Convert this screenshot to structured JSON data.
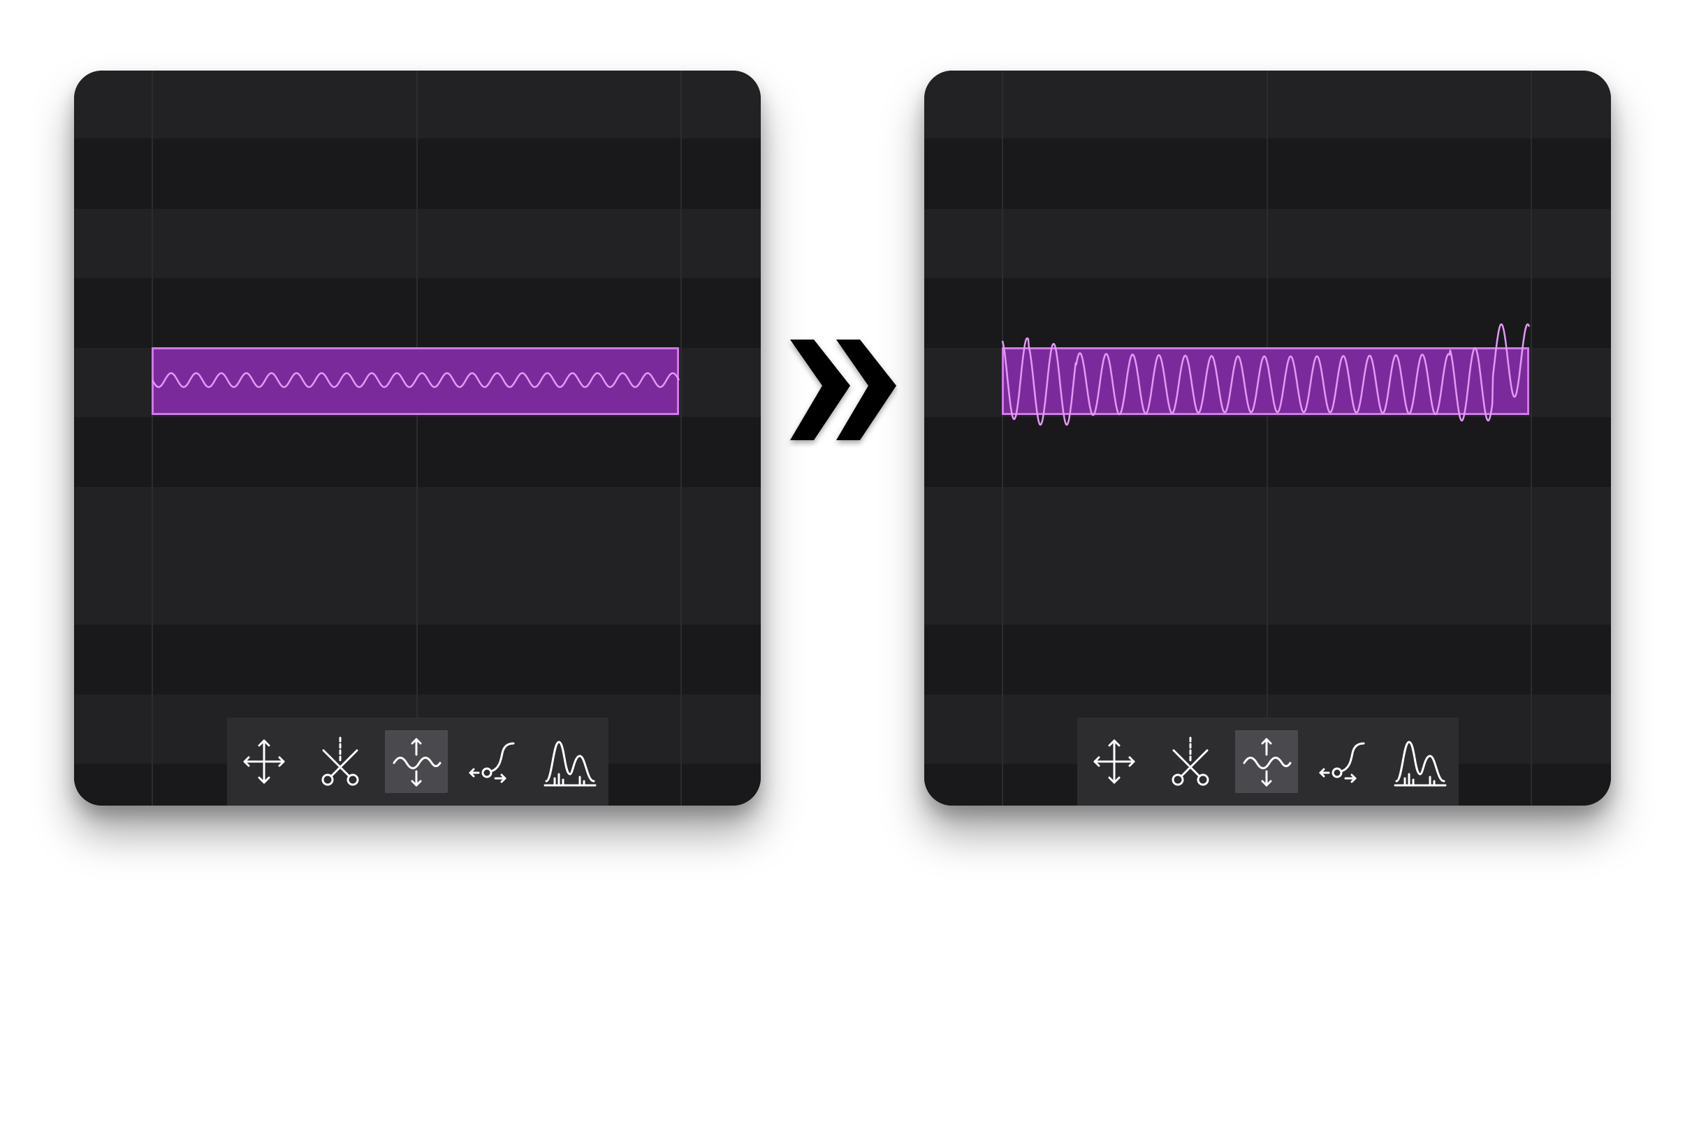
{
  "scene": "before-after-comparison",
  "colors": {
    "page_background": "#ffffff",
    "panel_stripe_light": "#222224",
    "panel_stripe_dark": "#19191b",
    "grid_line": "#2c2c2f",
    "note_fill": "#7b2a9c",
    "note_border": "#d07ae6",
    "waveform": "#e39af5",
    "toolbar_background": "#2d2d30",
    "toolbar_active": "#4a4a4e",
    "icon_color": "#ffffff",
    "arrow_color": "#000000"
  },
  "transition_icon": "double-chevron-right-icon",
  "panels": [
    {
      "id": "before",
      "waveform_style": "low-amplitude vibrato",
      "toolbar": {
        "active_tool": "pitch-modulation-tool",
        "tools": [
          {
            "id": "move-tool",
            "icon": "move-arrows-icon"
          },
          {
            "id": "split-tool",
            "icon": "scissors-icon"
          },
          {
            "id": "pitch-modulation-tool",
            "icon": "wave-updown-icon"
          },
          {
            "id": "pitch-drift-tool",
            "icon": "curve-handle-icon"
          },
          {
            "id": "formant-tool",
            "icon": "formant-peaks-icon"
          }
        ]
      }
    },
    {
      "id": "after",
      "waveform_style": "high-amplitude vibrato",
      "toolbar": {
        "active_tool": "pitch-modulation-tool",
        "tools": [
          {
            "id": "move-tool",
            "icon": "move-arrows-icon"
          },
          {
            "id": "split-tool",
            "icon": "scissors-icon"
          },
          {
            "id": "pitch-modulation-tool",
            "icon": "wave-updown-icon"
          },
          {
            "id": "pitch-drift-tool",
            "icon": "curve-handle-icon"
          },
          {
            "id": "formant-tool",
            "icon": "formant-peaks-icon"
          }
        ]
      }
    }
  ]
}
